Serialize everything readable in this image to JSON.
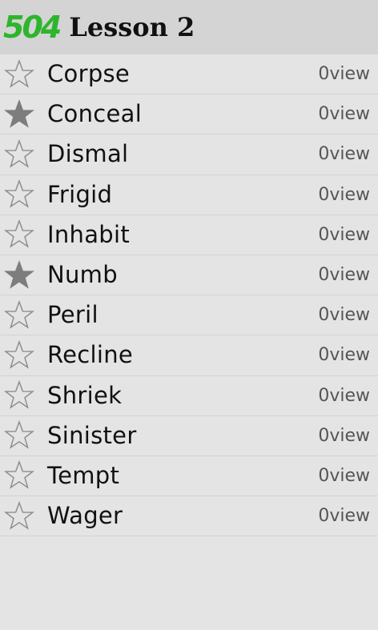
{
  "header": {
    "logo": "504",
    "title": "Lesson 2"
  },
  "words": [
    {
      "word": "Corpse",
      "starred": false,
      "views": "0view"
    },
    {
      "word": "Conceal",
      "starred": true,
      "views": "0view"
    },
    {
      "word": "Dismal",
      "starred": false,
      "views": "0view"
    },
    {
      "word": "Frigid",
      "starred": false,
      "views": "0view"
    },
    {
      "word": "Inhabit",
      "starred": false,
      "views": "0view"
    },
    {
      "word": "Numb",
      "starred": true,
      "views": "0view"
    },
    {
      "word": "Peril",
      "starred": false,
      "views": "0view"
    },
    {
      "word": "Recline",
      "starred": false,
      "views": "0view"
    },
    {
      "word": "Shriek",
      "starred": false,
      "views": "0view"
    },
    {
      "word": "Sinister",
      "starred": false,
      "views": "0view"
    },
    {
      "word": "Tempt",
      "starred": false,
      "views": "0view"
    },
    {
      "word": "Wager",
      "starred": false,
      "views": "0view"
    }
  ],
  "colors": {
    "logo": "#2db52d",
    "background": "#e4e4e4",
    "header": "#d4d4d4",
    "star_filled": "#7d7d7d"
  }
}
